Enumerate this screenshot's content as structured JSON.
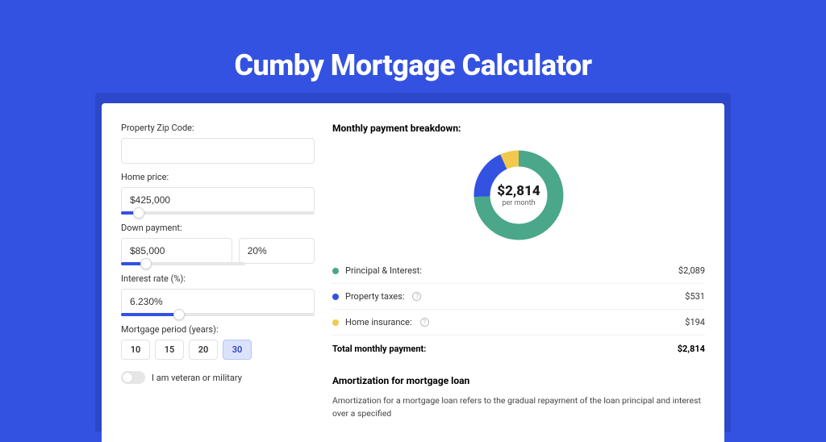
{
  "title": "Cumby Mortgage Calculator",
  "form": {
    "zip_label": "Property Zip Code:",
    "zip_value": "",
    "home_price_label": "Home price:",
    "home_price_value": "$425,000",
    "home_price_slider_pct": 9,
    "down_payment_label": "Down payment:",
    "down_payment_value": "$85,000",
    "down_payment_pct_value": "20%",
    "down_payment_slider_pct": 20,
    "interest_label": "Interest rate (%):",
    "interest_value": "6.230%",
    "interest_slider_pct": 30,
    "period_label": "Mortgage period (years):",
    "period_options": [
      "10",
      "15",
      "20",
      "30"
    ],
    "period_selected": "30",
    "veteran_label": "I am veteran or military",
    "veteran_on": false
  },
  "breakdown": {
    "title": "Monthly payment breakdown:",
    "total_amount": "$2,814",
    "total_sub": "per month",
    "items": [
      {
        "label": "Principal & Interest:",
        "value": "$2,089",
        "color": "#4aa789",
        "info": false
      },
      {
        "label": "Property taxes:",
        "value": "$531",
        "color": "#3352e1",
        "info": true
      },
      {
        "label": "Home insurance:",
        "value": "$194",
        "color": "#f2c94c",
        "info": true
      }
    ],
    "total_label": "Total monthly payment:",
    "total_value": "$2,814"
  },
  "chart_data": {
    "type": "pie",
    "title": "Monthly payment breakdown",
    "series": [
      {
        "name": "Principal & Interest",
        "value": 2089,
        "color": "#4aa789"
      },
      {
        "name": "Property taxes",
        "value": 531,
        "color": "#3352e1"
      },
      {
        "name": "Home insurance",
        "value": 194,
        "color": "#f2c94c"
      }
    ],
    "total": 2814,
    "center_label": "$2,814",
    "center_sub": "per month"
  },
  "amortization": {
    "title": "Amortization for mortgage loan",
    "text": "Amortization for a mortgage loan refers to the gradual repayment of the loan principal and interest over a specified"
  }
}
